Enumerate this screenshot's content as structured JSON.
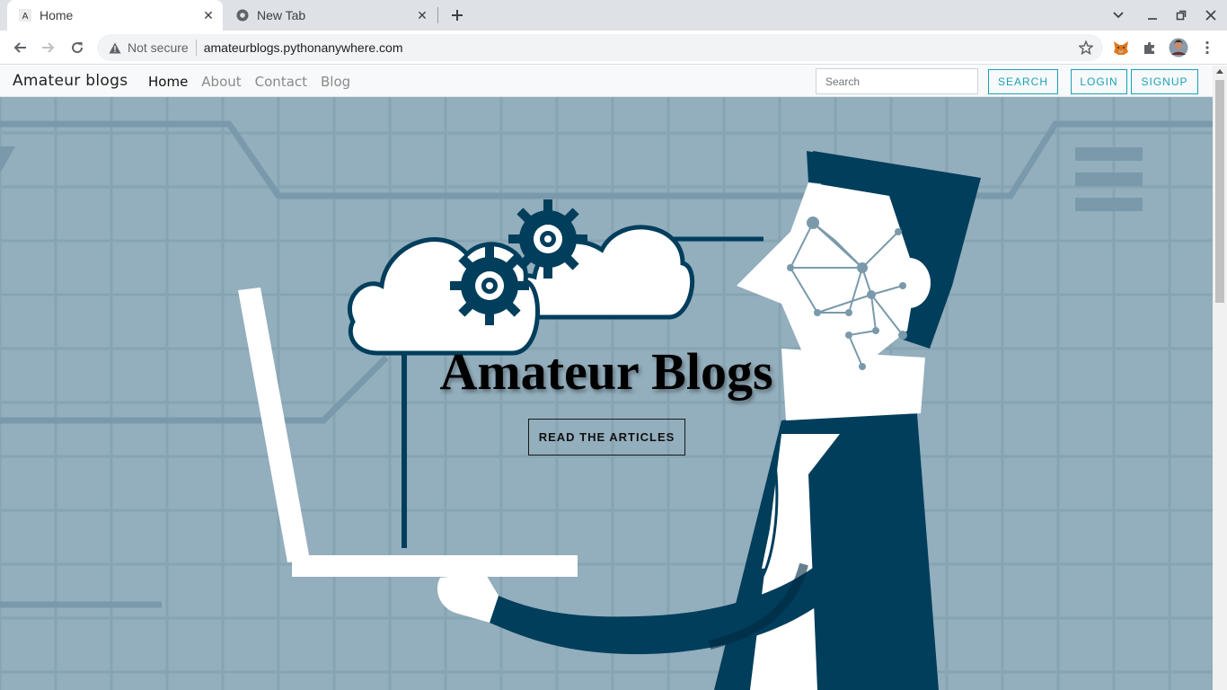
{
  "browser": {
    "tabs": [
      {
        "title": "Home",
        "favicon": "site-a-favicon",
        "active": true
      },
      {
        "title": "New Tab",
        "favicon": "chrome-favicon",
        "active": false
      }
    ],
    "address": {
      "security_label": "Not secure",
      "url": "amateurblogs.pythonanywhere.com"
    }
  },
  "navbar": {
    "brand": "Amateur blogs",
    "links": [
      "Home",
      "About",
      "Contact",
      "Blog"
    ],
    "search_placeholder": "Search",
    "search_button": "SEARCH",
    "login_button": "LOGIN",
    "signup_button": "SIGNUP"
  },
  "hero": {
    "title": "Amateur Blogs",
    "cta": "READ THE ARTICLES"
  },
  "colors": {
    "accent": "#17a2b8",
    "hero_bg": "#93aebd",
    "illustration_dark": "#003e5c"
  }
}
